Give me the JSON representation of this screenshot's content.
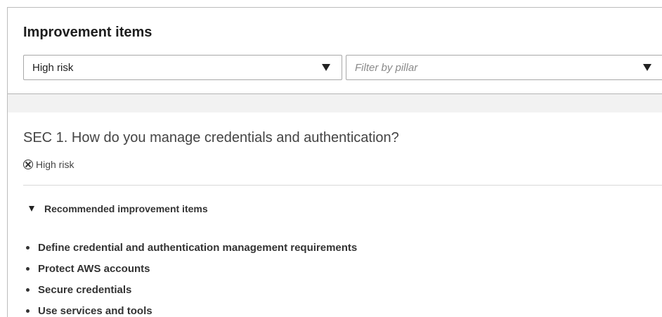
{
  "panel": {
    "title": "Improvement items",
    "risk_filter": {
      "selected": "High risk",
      "icon": "caret-down-icon"
    },
    "pillar_filter": {
      "placeholder": "Filter by pillar",
      "icon": "caret-down-icon"
    }
  },
  "question": {
    "title": "SEC 1. How do you manage credentials and authentication?",
    "risk": {
      "icon": "x-circle-icon",
      "label": "High risk"
    },
    "recommendations": {
      "label": "Recommended improvement items",
      "expanded": true,
      "items": [
        "Define credential and authentication management requirements",
        "Protect AWS accounts",
        "Secure credentials",
        "Use services and tools"
      ]
    }
  }
}
